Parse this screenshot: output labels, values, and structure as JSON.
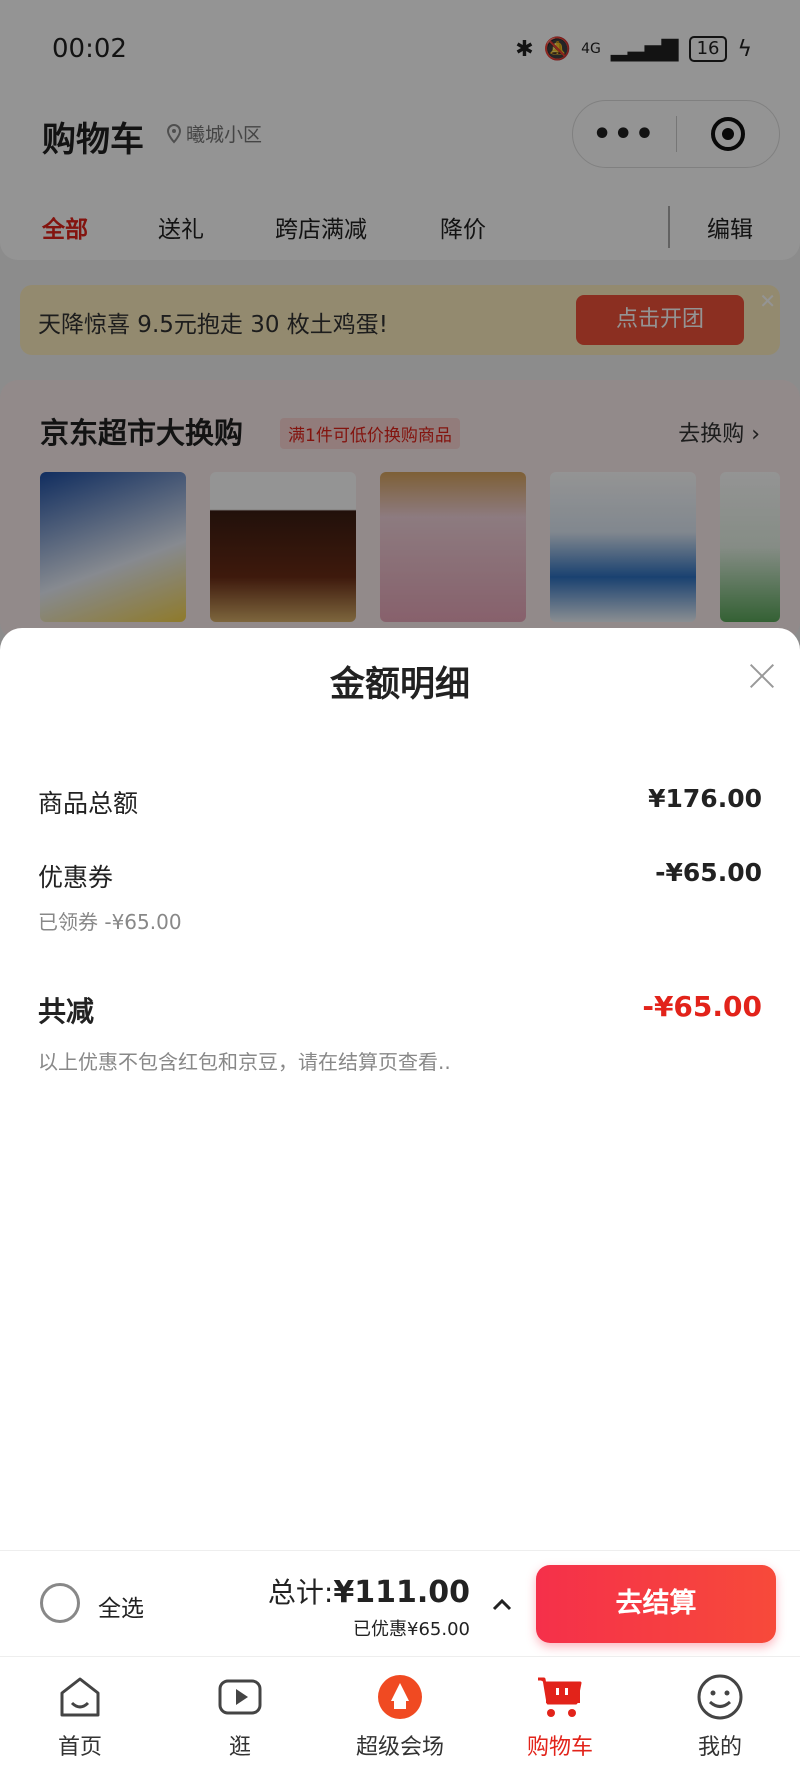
{
  "status_bar": {
    "time": "00:02",
    "network": "4G",
    "battery": "16"
  },
  "header": {
    "title": "购物车",
    "location": "曦城小区",
    "capsule_more": "•••"
  },
  "tabs": [
    {
      "label": "全部",
      "active": true
    },
    {
      "label": "送礼",
      "active": false
    },
    {
      "label": "跨店满减",
      "active": false
    },
    {
      "label": "降价",
      "active": false
    },
    {
      "label": "编辑",
      "active": false
    }
  ],
  "promo": {
    "text": "天降惊喜 9.5元抱走 30 枚土鸡蛋!",
    "button": "点击开团"
  },
  "swap": {
    "title": "京东超市大换购",
    "tag": "满1件可低价换购商品",
    "link": "去换购 ›"
  },
  "sheet": {
    "title": "金额明细",
    "goods_total_label": "商品总额",
    "goods_total_value": "¥176.00",
    "coupon_label": "优惠券",
    "coupon_value": "-¥65.00",
    "coupon_sub": "已领券 -¥65.00",
    "reduce_label": "共减",
    "reduce_value": "-¥65.00",
    "note": "以上优惠不包含红包和京豆，请在结算页查看.."
  },
  "checkout": {
    "select_all": "全选",
    "total_prefix": "总计:",
    "total_amount": "¥111.00",
    "saved": "已优惠¥65.00",
    "button": "去结算"
  },
  "nav": [
    {
      "label": "首页",
      "icon": "home-icon",
      "active": false
    },
    {
      "label": "逛",
      "icon": "video-icon",
      "active": false
    },
    {
      "label": "超级会场",
      "icon": "super-venue-icon",
      "active": false
    },
    {
      "label": "购物车",
      "icon": "cart-icon",
      "active": true
    },
    {
      "label": "我的",
      "icon": "profile-icon",
      "active": false
    }
  ],
  "colors": {
    "accent": "#e2231a",
    "checkout": "#f5304a",
    "promo_bg": "#fdeec0"
  }
}
